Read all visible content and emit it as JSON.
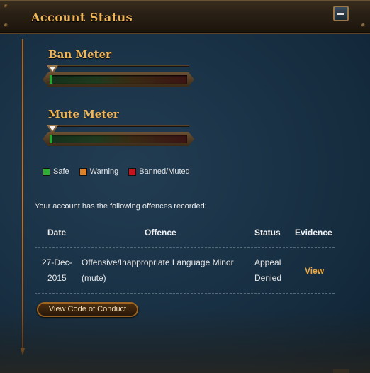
{
  "header": {
    "title": "Account Status"
  },
  "meters": {
    "ban": {
      "label": "Ban Meter",
      "level": 0.02
    },
    "mute": {
      "label": "Mute Meter",
      "level": 0.02
    }
  },
  "legend": [
    {
      "label": "Safe",
      "color": "#2fae36"
    },
    {
      "label": "Warning",
      "color": "#e0822a"
    },
    {
      "label": "Banned/Muted",
      "color": "#c4161c"
    }
  ],
  "offences": {
    "intro": "Your account has the following offences recorded:",
    "columns": [
      "Date",
      "Offence",
      "Status",
      "Evidence"
    ],
    "rows": [
      {
        "date_line1": "27-Dec-",
        "date_line2": "2015",
        "offence_line1": "Offensive/Inappropriate Language Minor",
        "offence_line2": "(mute)",
        "status_line1": "Appeal",
        "status_line2": "Denied",
        "evidence": "View"
      }
    ]
  },
  "buttons": {
    "conduct": "View Code of Conduct"
  },
  "colors": {
    "accent": "#f0b75a",
    "link": "#f0a93d",
    "panel": "#1a3246"
  }
}
